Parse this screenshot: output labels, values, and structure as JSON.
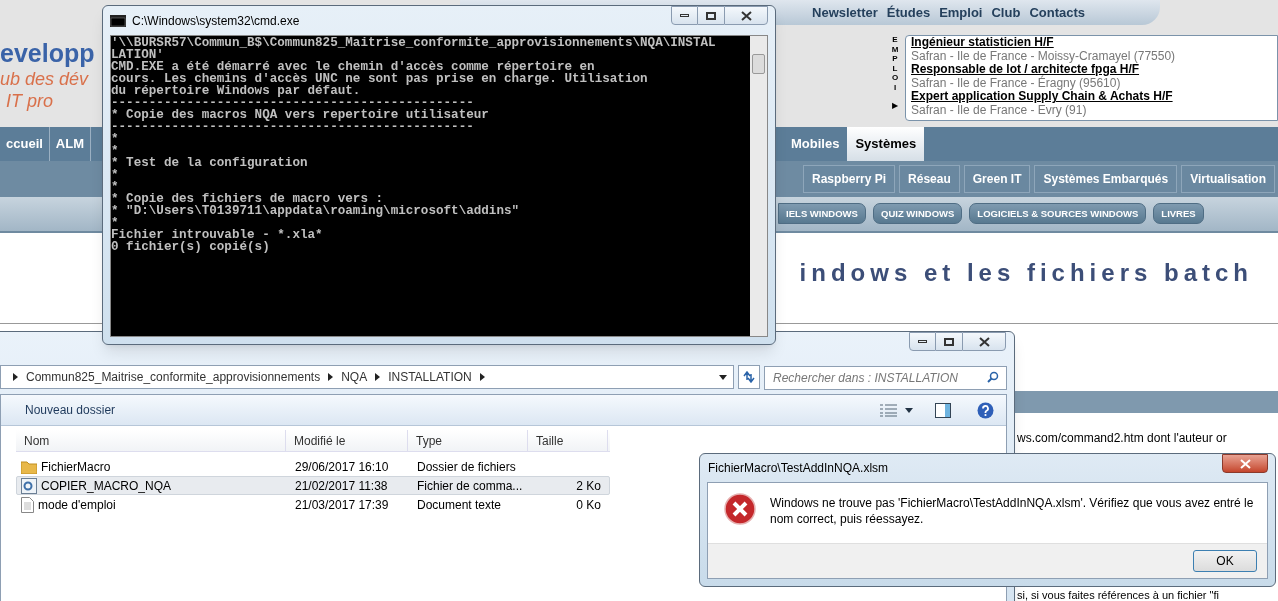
{
  "website": {
    "logo": {
      "name": "evelopp",
      "tagline_1": "ub des dév",
      "tagline_2": "IT pro"
    },
    "top_nav": [
      "Newsletter",
      "Études",
      "Emploi",
      "Club",
      "Contacts"
    ],
    "jobs": {
      "label": "EMPLOI",
      "arrow": "▶",
      "listings": [
        {
          "title": "Ingénieur statisticien H/F",
          "location": "Safran - Ile de France - Moissy-Cramayel (77550)"
        },
        {
          "title": "Responsable de lot / architecte fpga H/F",
          "location": "Safran - Ile de France - Éragny (95610)"
        },
        {
          "title": "Expert application Supply Chain & Achats H/F",
          "location": "Safran - Ile de France - Evry (91)"
        }
      ]
    },
    "main_menu_left": [
      {
        "label": "ccueil",
        "selected": false
      },
      {
        "label": "ALM",
        "selected": false
      }
    ],
    "main_menu_right": [
      {
        "label": "Mobiles",
        "selected": false
      },
      {
        "label": "Systèmes",
        "selected": true
      }
    ],
    "sub_menu": [
      "Raspberry Pi",
      "Réseau",
      "Green IT",
      "Systèmes Embarqués",
      "Virtualisation"
    ],
    "section_buttons": [
      "IELS WINDOWS",
      "QUIZ WINDOWS",
      "LOGICIELS & SOURCES WINDOWS",
      "LIVRES"
    ],
    "heading": "indows et les fichiers batch",
    "body_fragments": [
      "ws.com/command2.htm dont l'auteur or",
      "si, si vous faites références à un fichier \"fi"
    ]
  },
  "cmd_window": {
    "title": "C:\\Windows\\system32\\cmd.exe",
    "lines": [
      "'\\\\BURSR57\\Commun_B$\\Commun825_Maitrise_conformite_approvisionnements\\NQA\\INSTAL",
      "LATION'",
      "CMD.EXE a été démarré avec le chemin d'accès comme répertoire en",
      "cours. Les chemins d'accès UNC ne sont pas prise en charge. Utilisation",
      "du répertoire Windows par défaut.",
      "------------------------------------------------",
      "* Copie des macros NQA vers repertoire utilisateur",
      "------------------------------------------------",
      "*",
      "*",
      "* Test de la configuration",
      "*",
      "*",
      "* Copie des fichiers de macro vers :",
      "* \"D:\\Users\\T0139711\\appdata\\roaming\\microsoft\\addins\"",
      "*",
      "Fichier introuvable - *.xla*",
      "0 fichier(s) copié(s)"
    ]
  },
  "explorer": {
    "breadcrumb": [
      "Commun825_Maitrise_conformite_approvisionnements",
      "NQA",
      "INSTALLATION"
    ],
    "search": {
      "placeholder": "Rechercher dans : INSTALLATION"
    },
    "new_folder": "Nouveau dossier",
    "columns": [
      "Nom",
      "Modifié le",
      "Type",
      "Taille"
    ],
    "rows": [
      {
        "kind": "folder",
        "name": "FichierMacro",
        "modified": "29/06/2017 16:10",
        "type": "Dossier de fichiers",
        "size": "",
        "selected": false
      },
      {
        "kind": "batch",
        "name": "COPIER_MACRO_NQA",
        "modified": "21/02/2017 11:38",
        "type": "Fichier de comma...",
        "size": "2 Ko",
        "selected": true
      },
      {
        "kind": "text",
        "name": "mode d'emploi",
        "modified": "21/03/2017 17:39",
        "type": "Document texte",
        "size": "0 Ko",
        "selected": false
      }
    ]
  },
  "dialog": {
    "title": "FichierMacro\\TestAddInNQA.xlsm",
    "message": "Windows ne trouve pas 'FichierMacro\\TestAddInNQA.xlsm'. Vérifiez que vous avez entré le nom correct, puis réessayez.",
    "button": "OK"
  }
}
